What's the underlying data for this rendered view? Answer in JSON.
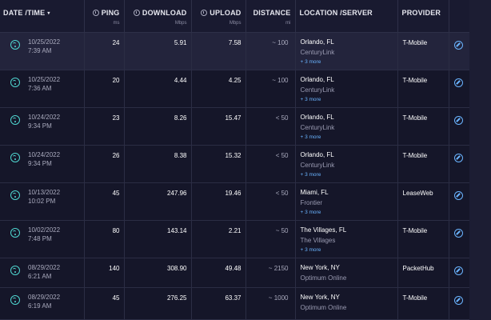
{
  "columns": {
    "datetime": "DATE /TIME",
    "ping": "PING",
    "ping_unit": "ms",
    "download": "DOWNLOAD",
    "download_unit": "Mbps",
    "upload": "UPLOAD",
    "upload_unit": "Mbps",
    "distance": "DISTANCE",
    "distance_unit": "mi",
    "location": "LOCATION /SERVER",
    "provider": "PROVIDER"
  },
  "sort_indicator": "▾",
  "delete_glyph": "×",
  "rows": [
    {
      "date": "10/25/2022",
      "time": "7:39 AM",
      "ping": "24",
      "download": "5.91",
      "upload": "7.58",
      "distance": "~ 100",
      "city": "Orlando, FL",
      "isp": "CenturyLink",
      "more": "+ 3 more",
      "provider": "T-Mobile"
    },
    {
      "date": "10/25/2022",
      "time": "7:36 AM",
      "ping": "20",
      "download": "4.44",
      "upload": "4.25",
      "distance": "~ 100",
      "city": "Orlando, FL",
      "isp": "CenturyLink",
      "more": "+ 3 more",
      "provider": "T-Mobile"
    },
    {
      "date": "10/24/2022",
      "time": "9:34 PM",
      "ping": "23",
      "download": "8.26",
      "upload": "15.47",
      "distance": "< 50",
      "city": "Orlando, FL",
      "isp": "CenturyLink",
      "more": "+ 3 more",
      "provider": "T-Mobile"
    },
    {
      "date": "10/24/2022",
      "time": "9:34 PM",
      "ping": "26",
      "download": "8.38",
      "upload": "15.32",
      "distance": "< 50",
      "city": "Orlando, FL",
      "isp": "CenturyLink",
      "more": "+ 3 more",
      "provider": "T-Mobile"
    },
    {
      "date": "10/13/2022",
      "time": "10:02 PM",
      "ping": "45",
      "download": "247.96",
      "upload": "19.46",
      "distance": "< 50",
      "city": "Miami, FL",
      "isp": "Frontier",
      "more": "+ 3 more",
      "provider": "LeaseWeb"
    },
    {
      "date": "10/02/2022",
      "time": "7:48 PM",
      "ping": "80",
      "download": "143.14",
      "upload": "2.21",
      "distance": "~ 50",
      "city": "The Villages, FL",
      "isp": "The Villages",
      "more": "+ 3 more",
      "provider": "T-Mobile"
    },
    {
      "date": "08/29/2022",
      "time": "6:21 AM",
      "ping": "140",
      "download": "308.90",
      "upload": "49.48",
      "distance": "~ 2150",
      "city": "New York, NY",
      "isp": "Optimum Online",
      "more": "",
      "provider": "PacketHub"
    },
    {
      "date": "08/29/2022",
      "time": "6:19 AM",
      "ping": "45",
      "download": "276.25",
      "upload": "63.37",
      "distance": "~ 1000",
      "city": "New York, NY",
      "isp": "Optimum Online",
      "more": "",
      "provider": "T-Mobile"
    }
  ],
  "colors": {
    "background": "#141526",
    "accent": "#6ab4ff",
    "wifi": "#4fd6d0",
    "delete": "#e05a6a"
  }
}
